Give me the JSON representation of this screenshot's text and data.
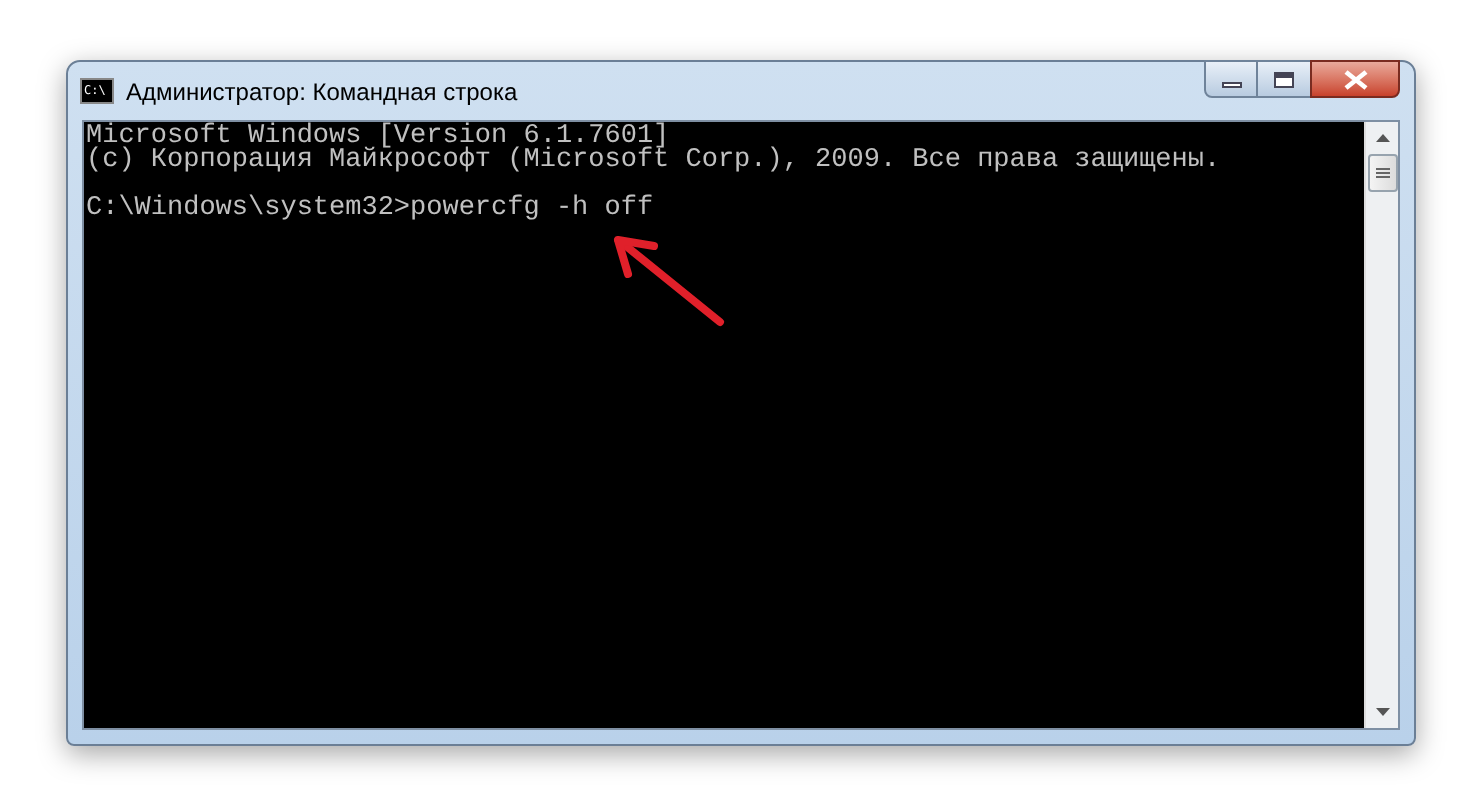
{
  "window": {
    "title": "Администратор: Командная строка",
    "icon_text": "C:\\"
  },
  "console": {
    "banner": [
      "Microsoft Windows [Version 6.1.7601]",
      "(c) Корпорация Майкрософт (Microsoft Corp.), 2009. Все права защищены."
    ],
    "command_line": "C:\\Windows\\system32>powercfg -h off"
  }
}
